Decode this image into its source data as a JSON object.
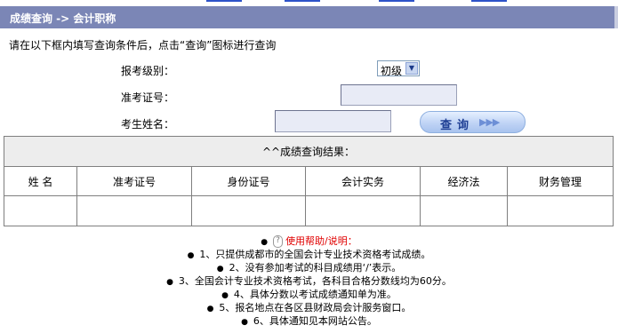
{
  "header": {
    "title": "成绩查询 -> 会计职称"
  },
  "instruction": "请在以下框内填写查询条件后，点击“查询”图标进行查询",
  "form": {
    "level_label": "报考级别：",
    "level_value": "初级",
    "admission_label": "准考证号：",
    "admission_value": "",
    "name_label": "考生姓名：",
    "name_value": "",
    "query_button": "查询"
  },
  "results": {
    "caption": "^^成绩查询结果：",
    "columns": [
      "姓 名",
      "准考证号",
      "身份证号",
      "会计实务",
      "经济法",
      "财务管理"
    ],
    "rows": [
      [
        "",
        "",
        "",
        "",
        "",
        ""
      ]
    ]
  },
  "help": {
    "title": "使用帮助/说明：",
    "items": [
      "1、只提供成都市的全国会计专业技术资格考试成绩。",
      "2、没有参加考试的科目成绩用‘/’表示。",
      "3、全国会计专业技术资格考试，各科目合格分数线均为60分。",
      "4、具体分数以考试成绩通知单为准。",
      "5、报名地点在各区县财政局会计服务窗口。",
      "6、具体通知见本网站公告。"
    ]
  },
  "colors": {
    "header_bg": "#7b86b6",
    "input_bg": "#e8ebf6",
    "help_title": "#e00000"
  },
  "icons": {
    "dropdown": "chevron-down-icon",
    "help": "question-icon",
    "button_arrows": "triple-arrow-icon"
  }
}
